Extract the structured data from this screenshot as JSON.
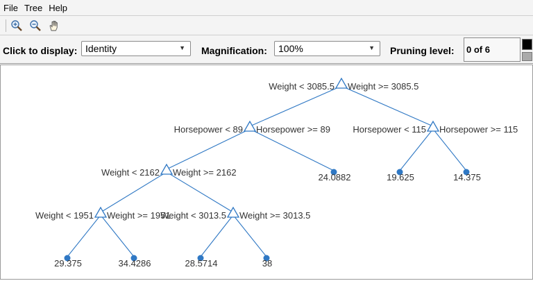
{
  "menu": {
    "file": "File",
    "tree": "Tree",
    "help": "Help"
  },
  "toolbar": {
    "zoom_in": "zoom-in",
    "zoom_out": "zoom-out",
    "pan": "pan"
  },
  "controls": {
    "display_label": "Click to display:",
    "display_value": "Identity",
    "magnification_label": "Magnification:",
    "magnification_value": "100%",
    "pruning_label": "Pruning level:",
    "pruning_value": "0 of 6"
  },
  "tree": {
    "node_color": "#2f78c4",
    "split_labels": [
      {
        "left": "Weight < 3085.5",
        "right": "Weight >= 3085.5"
      },
      {
        "left": "Horsepower < 89",
        "right": "Horsepower >= 89"
      },
      {
        "left": "Horsepower < 115",
        "right": "Horsepower >= 115"
      },
      {
        "left": "Weight < 2162",
        "right": "Weight >= 2162"
      },
      {
        "left": "Weight < 1951",
        "right": "Weight >= 1951"
      },
      {
        "left": "Weight < 3013.5",
        "right": "Weight >= 3013.5"
      }
    ],
    "leaf_values": [
      "24.0882",
      "19.625",
      "14.375",
      "29.375",
      "34.4286",
      "28.5714",
      "38"
    ]
  }
}
